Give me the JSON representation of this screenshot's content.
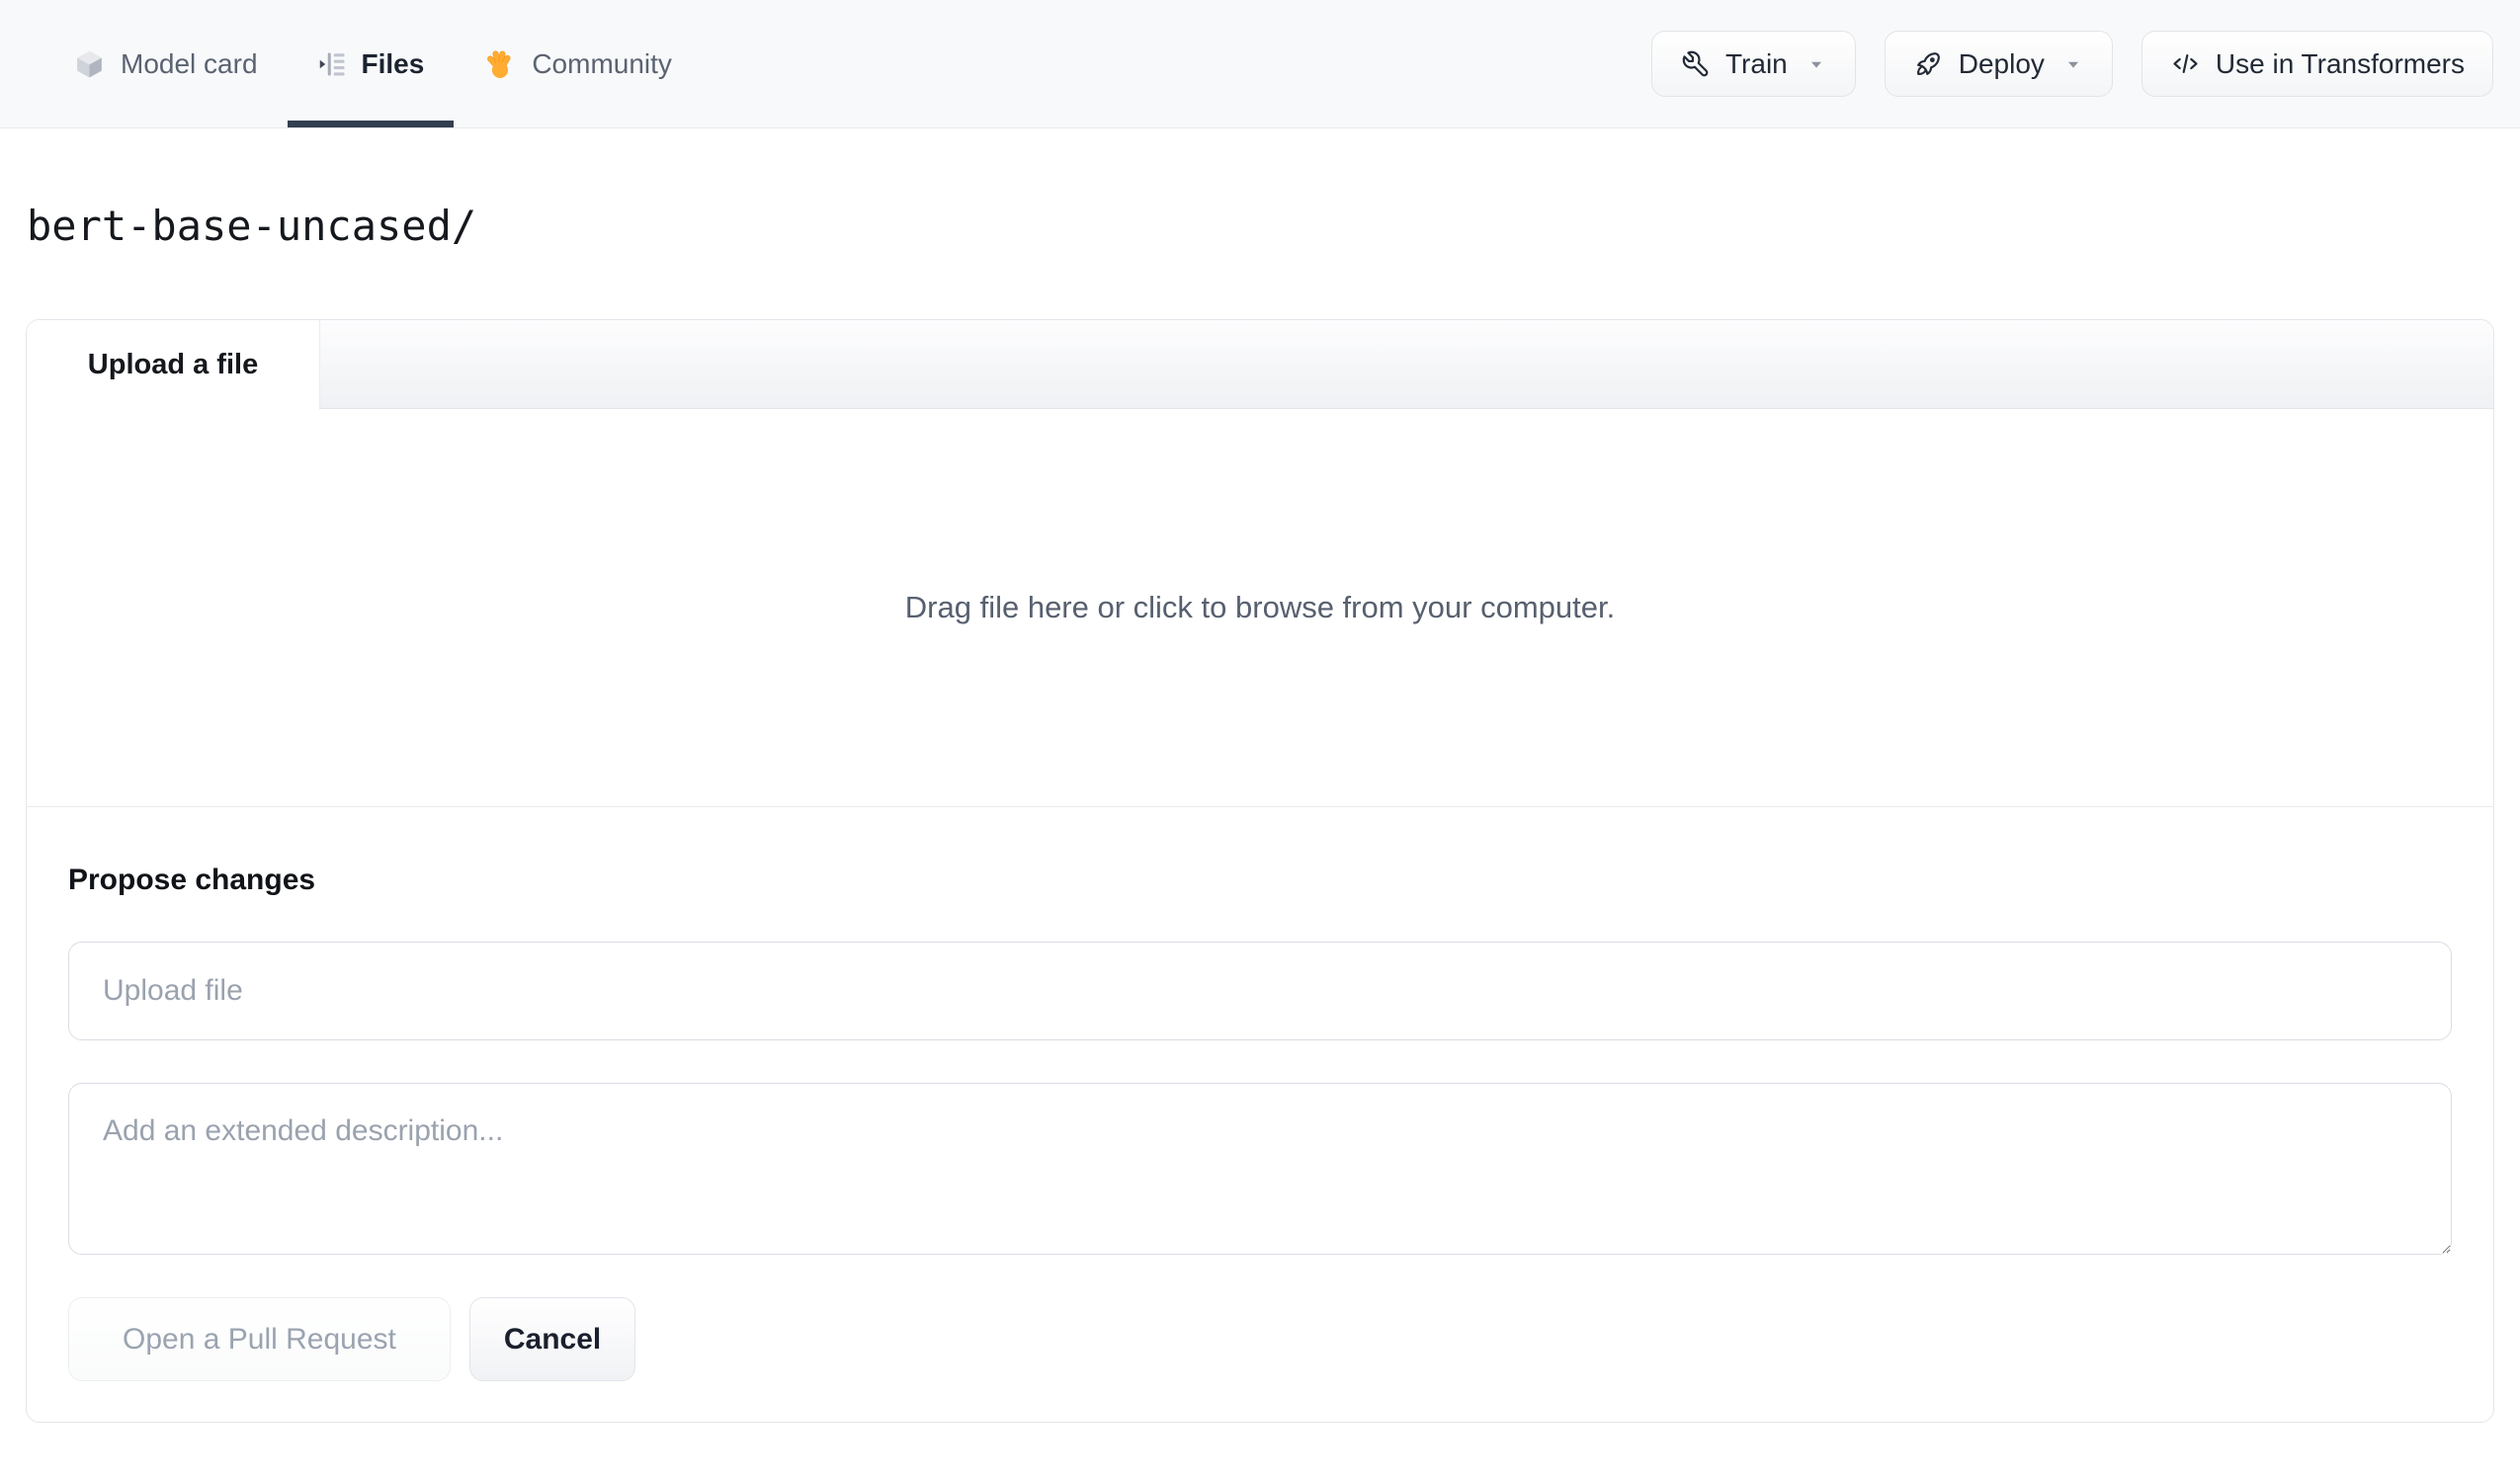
{
  "nav": {
    "tabs": [
      {
        "label": "Model card",
        "icon": "cube-icon",
        "active": false
      },
      {
        "label": "Files",
        "icon": "file-versions-icon",
        "active": true
      },
      {
        "label": "Community",
        "icon": "waving-hand-icon",
        "active": false
      }
    ],
    "actions": [
      {
        "label": "Train",
        "icon": "wrench-icon",
        "has_dropdown": true
      },
      {
        "label": "Deploy",
        "icon": "rocket-icon",
        "has_dropdown": true
      },
      {
        "label": "Use in Transformers",
        "icon": "code-icon",
        "has_dropdown": false
      }
    ]
  },
  "breadcrumb": {
    "path": "bert-base-uncased/"
  },
  "upload_panel": {
    "tab_label": "Upload a file",
    "dropzone_text": "Drag file here or click to browse from your computer.",
    "propose": {
      "heading": "Propose changes",
      "file_input_placeholder": "Upload file",
      "description_placeholder": "Add an extended description...",
      "submit_label": "Open a Pull Request",
      "cancel_label": "Cancel"
    }
  },
  "colors": {
    "active_tab_underline": "#333e50",
    "nav_background": "#f8f9fb",
    "panel_border": "#e3e6ea",
    "muted_text": "#57606f",
    "placeholder_text": "#9aa2ae",
    "disabled_text": "#9ba3b0",
    "hand_emoji_orange": "#FFAC33"
  }
}
